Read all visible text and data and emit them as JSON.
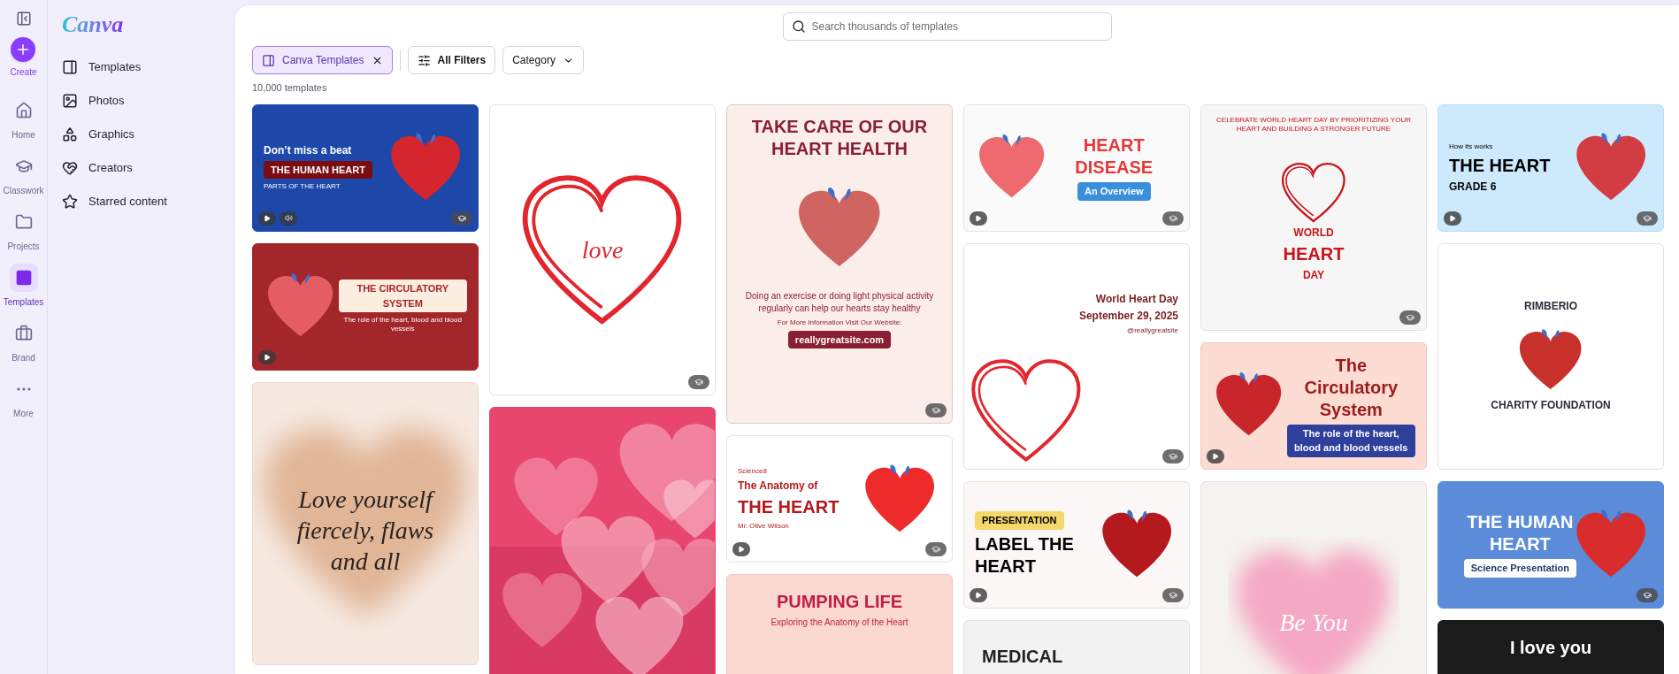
{
  "rail": {
    "create": {
      "label": "Create"
    },
    "items": [
      {
        "label": "Home",
        "selected": false
      },
      {
        "label": "Classwork",
        "selected": false
      },
      {
        "label": "Projects",
        "selected": false
      },
      {
        "label": "Templates",
        "selected": true
      },
      {
        "label": "Brand",
        "selected": false
      },
      {
        "label": "More",
        "selected": false
      }
    ]
  },
  "panel": {
    "logo": "Canva",
    "items": [
      {
        "label": "Templates"
      },
      {
        "label": "Photos"
      },
      {
        "label": "Graphics"
      },
      {
        "label": "Creators"
      },
      {
        "label": "Starred content"
      }
    ]
  },
  "search": {
    "placeholder": "Search thousands of templates"
  },
  "filters": {
    "chip": {
      "label": "Canva Templates",
      "selected": true
    },
    "all_filters": "All Filters",
    "category": "Category"
  },
  "count": "10,000 templates",
  "columns": [
    {
      "cards": [
        {
          "kind": "anatomy",
          "video": true,
          "audio": true,
          "classroom": true,
          "texts": [
            {
              "kind": "eyebrow",
              "text": "Don’t miss a beat"
            },
            {
              "kind": "tag",
              "text": "THE HUMAN HEART"
            },
            {
              "kind": "fine",
              "text": "PARTS OF THE HEART"
            }
          ]
        },
        {
          "kind": "circulatory",
          "video": true,
          "audio": false,
          "classroom": false,
          "texts": [
            {
              "kind": "tag",
              "text": "THE CIRCULATORY SYSTEM"
            },
            {
              "kind": "fine",
              "text": "The role of the heart, blood and blood vessels"
            }
          ]
        },
        {
          "kind": "affirmation",
          "video": false,
          "audio": false,
          "classroom": false,
          "texts": [
            {
              "kind": "script",
              "text": "Love yourself fiercely, flaws and all"
            }
          ]
        }
      ]
    },
    {
      "cards": [
        {
          "kind": "doodle",
          "video": false,
          "audio": false,
          "classroom": true,
          "texts": [
            {
              "kind": "script",
              "text": "love"
            }
          ]
        },
        {
          "kind": "bokeh",
          "video": false,
          "audio": false,
          "classroom": false
        }
      ]
    },
    {
      "cards": [
        {
          "kind": "poster",
          "video": false,
          "audio": false,
          "classroom": true,
          "texts": [
            {
              "kind": "title",
              "text": "TAKE CARE OF OUR HEART HEALTH"
            },
            {
              "kind": "body",
              "text": "Doing an exercise or doing light physical activity regularly can help our hearts stay healthy"
            },
            {
              "kind": "fine",
              "text": "For More  Information Visit Our Website:"
            },
            {
              "kind": "tag",
              "text": "reallygreatsite.com"
            }
          ]
        },
        {
          "kind": "cartoon",
          "video": true,
          "audio": false,
          "classroom": true,
          "texts": [
            {
              "kind": "fine",
              "text": "Science8"
            },
            {
              "kind": "eyebrow",
              "text": "The Anatomy of"
            },
            {
              "kind": "title",
              "text": "THE HEART"
            },
            {
              "kind": "fine",
              "text": "Mr. Olive Wilson"
            }
          ]
        },
        {
          "kind": "pumping",
          "video": false,
          "audio": false,
          "classroom": false,
          "texts": [
            {
              "kind": "title",
              "text": "PUMPING LIFE"
            },
            {
              "kind": "body",
              "text": "Exploring the Anatomy of the Heart"
            }
          ]
        }
      ]
    },
    {
      "cards": [
        {
          "kind": "disease",
          "video": true,
          "audio": false,
          "classroom": true,
          "texts": [
            {
              "kind": "title",
              "text": "HEART DISEASE"
            },
            {
              "kind": "tag",
              "text": "An Overview"
            }
          ]
        },
        {
          "kind": "worldday",
          "video": false,
          "audio": false,
          "classroom": true,
          "texts": [
            {
              "kind": "eyebrow",
              "text": "World Heart Day"
            },
            {
              "kind": "eyebrow",
              "text": "September 29, 2025"
            },
            {
              "kind": "fine",
              "text": "@reallygreatsite"
            }
          ]
        },
        {
          "kind": "label",
          "video": true,
          "audio": false,
          "classroom": true,
          "texts": [
            {
              "kind": "tag",
              "text": "PRESENTATION"
            },
            {
              "kind": "title",
              "text": "LABEL THE HEART"
            }
          ]
        },
        {
          "kind": "medical",
          "video": false,
          "audio": false,
          "classroom": false,
          "texts": [
            {
              "kind": "title",
              "text": "MEDICAL"
            }
          ]
        }
      ]
    },
    {
      "cards": [
        {
          "kind": "sketch",
          "video": false,
          "audio": false,
          "classroom": true,
          "texts": [
            {
              "kind": "fine",
              "text": "CELEBRATE WORLD HEART DAY BY PRIORITIZING YOUR HEART AND BUILDING A STRONGER FUTURE"
            },
            {
              "kind": "eyebrow",
              "text": "WORLD"
            },
            {
              "kind": "title",
              "text": "HEART"
            },
            {
              "kind": "eyebrow",
              "text": "DAY"
            }
          ]
        },
        {
          "kind": "blood",
          "video": true,
          "audio": false,
          "classroom": false,
          "texts": [
            {
              "kind": "title",
              "text": "The Circulatory System"
            },
            {
              "kind": "tag",
              "text": "The role of the heart, blood and blood vessels"
            }
          ]
        },
        {
          "kind": "glow",
          "video": false,
          "audio": false,
          "classroom": false,
          "texts": [
            {
              "kind": "script",
              "text": "Be You"
            }
          ]
        }
      ]
    },
    {
      "cards": [
        {
          "kind": "grid",
          "video": true,
          "audio": false,
          "classroom": true,
          "texts": [
            {
              "kind": "fine",
              "text": "How its works"
            },
            {
              "kind": "title",
              "text": "THE HEART"
            },
            {
              "kind": "eyebrow",
              "text": "GRADE 6"
            }
          ]
        },
        {
          "kind": "charity",
          "video": false,
          "audio": false,
          "classroom": false,
          "texts": [
            {
              "kind": "eyebrow",
              "text": "RIMBERIO"
            },
            {
              "kind": "eyebrow",
              "text": "CHARITY FOUNDATION"
            }
          ]
        },
        {
          "kind": "bluecard",
          "video": false,
          "audio": false,
          "classroom": true,
          "texts": [
            {
              "kind": "title",
              "text": "THE HUMAN HEART"
            },
            {
              "kind": "tag",
              "text": "Science Presentation"
            }
          ]
        },
        {
          "kind": "paper",
          "video": false,
          "audio": false,
          "classroom": false,
          "texts": [
            {
              "kind": "title",
              "text": "I love you"
            }
          ]
        }
      ]
    }
  ]
}
